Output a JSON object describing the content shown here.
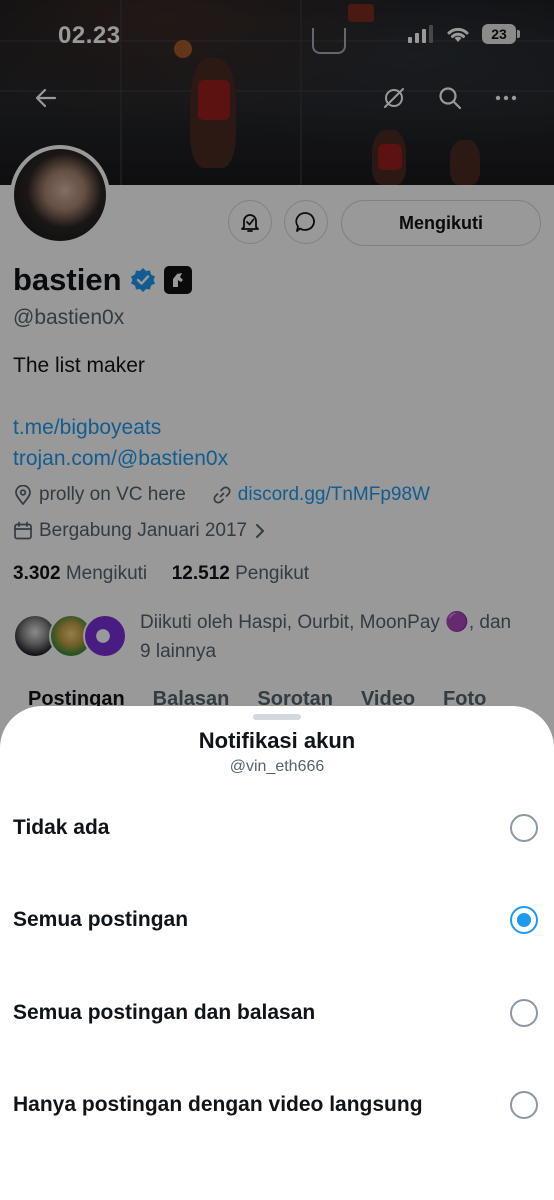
{
  "status_bar": {
    "time": "02.23",
    "battery": "23"
  },
  "profile": {
    "name": "bastien",
    "handle": "@bastien0x",
    "bio": "The list maker",
    "links": [
      "t.me/bigboyeats",
      "trojan.com/@bastien0x"
    ],
    "location": "prolly on VC here",
    "website": "discord.gg/TnMFp98W",
    "joined": "Bergabung Januari 2017",
    "following_count": "3.302",
    "following_label": "Mengikuti",
    "followers_count": "12.512",
    "followers_label": "Pengikut",
    "follow_button": "Mengikuti",
    "followed_by_line1": "Diikuti oleh Haspi, Ourbit, MoonPay 🟣, dan",
    "followed_by_line2": "9 lainnya"
  },
  "tabs": [
    "Postingan",
    "Balasan",
    "Sorotan",
    "Video",
    "Foto"
  ],
  "sheet": {
    "title": "Notifikasi akun",
    "subtitle": "@vin_eth666",
    "options": [
      {
        "label": "Tidak ada",
        "selected": false
      },
      {
        "label": "Semua postingan",
        "selected": true
      },
      {
        "label": "Semua postingan dan balasan",
        "selected": false
      },
      {
        "label": "Hanya postingan dengan video langsung",
        "selected": false
      }
    ]
  },
  "colors": {
    "accent": "#1d9bf0",
    "text": "#0f1419",
    "secondary": "#536471"
  }
}
